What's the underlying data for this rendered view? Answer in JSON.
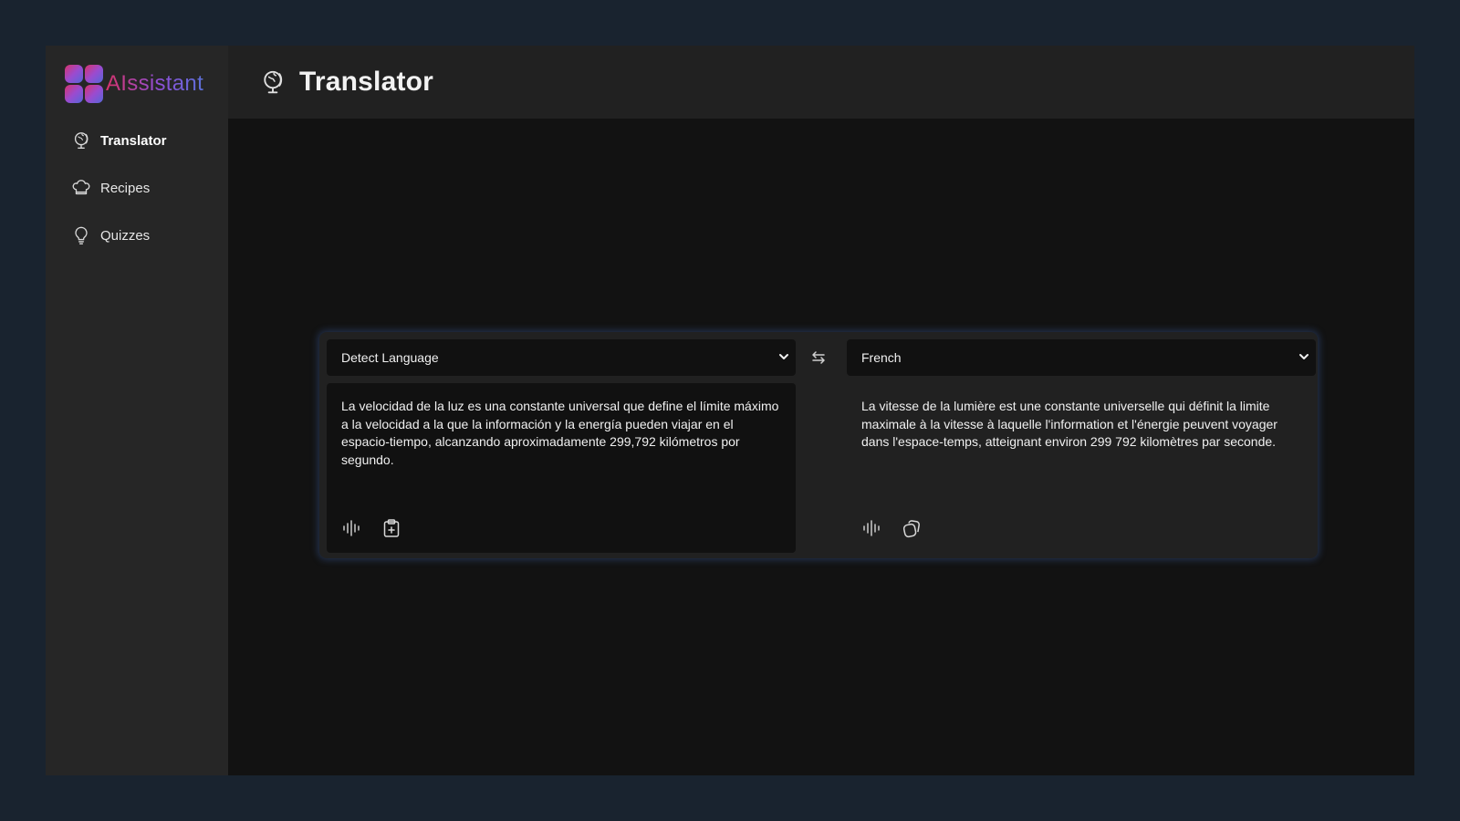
{
  "app": {
    "name": "AIssistant"
  },
  "sidebar": {
    "items": [
      {
        "label": "Translator",
        "icon": "globe-icon",
        "active": true
      },
      {
        "label": "Recipes",
        "icon": "chef-hat-icon",
        "active": false
      },
      {
        "label": "Quizzes",
        "icon": "lightbulb-icon",
        "active": false
      }
    ]
  },
  "header": {
    "title": "Translator",
    "icon": "globe-icon"
  },
  "translator": {
    "source_language": "Detect Language",
    "target_language": "French",
    "source_text": "La velocidad de la luz es una constante universal que define el límite máximo a la velocidad a la que la información y la energía pueden viajar en el espacio-tiempo, alcanzando aproximadamente 299,792 kilómetros por segundo.",
    "translated_text": "La vitesse de la lumière est une constante universelle qui définit la limite maximale à la vitesse à laquelle l'information et l'énergie peuvent voyager dans l'espace-temps, atteignant environ 299 792 kilomètres par seconde."
  },
  "colors": {
    "page_background": "#19232f",
    "sidebar": "#262626",
    "header": "#212121",
    "content": "#121212",
    "panel_glow": "#466ebe",
    "logo_gradient_start": "#d6336c",
    "logo_gradient_end": "#5b6fd6"
  }
}
